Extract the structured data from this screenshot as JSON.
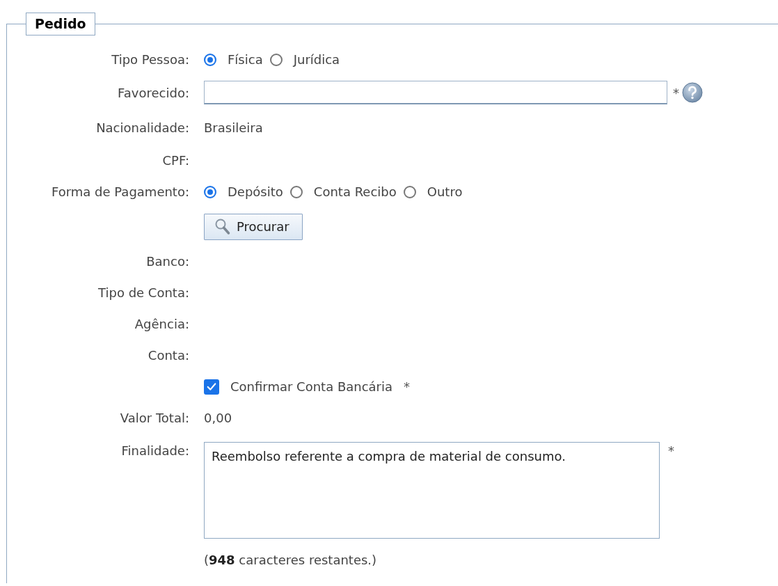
{
  "section": {
    "title": "Pedido"
  },
  "rows": [
    {
      "kind": "radio",
      "label": "Tipo Pessoa:",
      "options": [
        {
          "label": "Física",
          "selected": true
        },
        {
          "label": "Jurídica",
          "selected": false
        }
      ]
    },
    {
      "kind": "input",
      "label": "Favorecido:",
      "required_mark": "*",
      "help": true
    },
    {
      "kind": "text",
      "label": "Nacionalidade:",
      "value": "Brasileira"
    },
    {
      "kind": "text",
      "label": "CPF:"
    },
    {
      "kind": "radio",
      "label": "Forma de Pagamento:",
      "options": [
        {
          "label": "Depósito",
          "selected": true
        },
        {
          "label": "Conta Recibo",
          "selected": false
        },
        {
          "label": "Outro",
          "selected": false
        }
      ]
    },
    {
      "kind": "button",
      "button": "Procurar"
    },
    {
      "kind": "text",
      "label": "Banco:"
    },
    {
      "kind": "text",
      "label": "Tipo de Conta:"
    },
    {
      "kind": "text",
      "label": "Agência:"
    },
    {
      "kind": "text",
      "label": "Conta:"
    },
    {
      "kind": "checkbox",
      "text": "Confirmar Conta Bancária",
      "checked": true,
      "required_mark": "*"
    },
    {
      "kind": "text",
      "label": "Valor Total:",
      "value": "0,00"
    },
    {
      "kind": "textarea",
      "label": "Finalidade:",
      "value": "Reembolso referente a compra de material de consumo.",
      "required_mark": "*"
    },
    {
      "kind": "note",
      "text": "(**948** caracteres restantes.)"
    }
  ]
}
